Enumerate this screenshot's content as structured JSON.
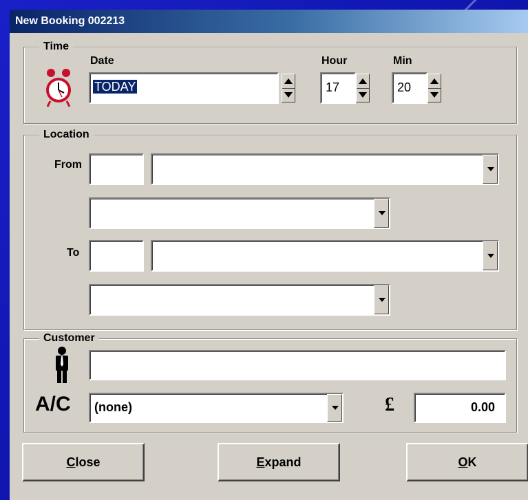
{
  "window": {
    "title": "New Booking 002213"
  },
  "time": {
    "group_label": "Time",
    "date_label": "Date",
    "date_value": "TODAY",
    "hour_label": "Hour",
    "hour_value": "17",
    "min_label": "Min",
    "min_value": "20",
    "icon": "alarm-clock-icon"
  },
  "location": {
    "group_label": "Location",
    "from_label": "From",
    "to_label": "To",
    "from_code": "",
    "from_address": "",
    "from_area": "",
    "to_code": "",
    "to_address": "",
    "to_area": ""
  },
  "customer": {
    "group_label": "Customer",
    "name_value": "",
    "person_icon": "person-icon",
    "ac_label": "A/C",
    "account_value": "(none)",
    "currency_symbol": "£",
    "fare_value": "0.00"
  },
  "buttons": {
    "close_prefix": "C",
    "close_rest": "lose",
    "expand_prefix": "E",
    "expand_rest": "xpand",
    "ok_prefix": "O",
    "ok_rest": "K"
  },
  "colors": {
    "desktop": "#1a20c8",
    "titlebar": "#0a246a",
    "window": "#d4d0c8",
    "alarm_clock": "#c8102e"
  }
}
